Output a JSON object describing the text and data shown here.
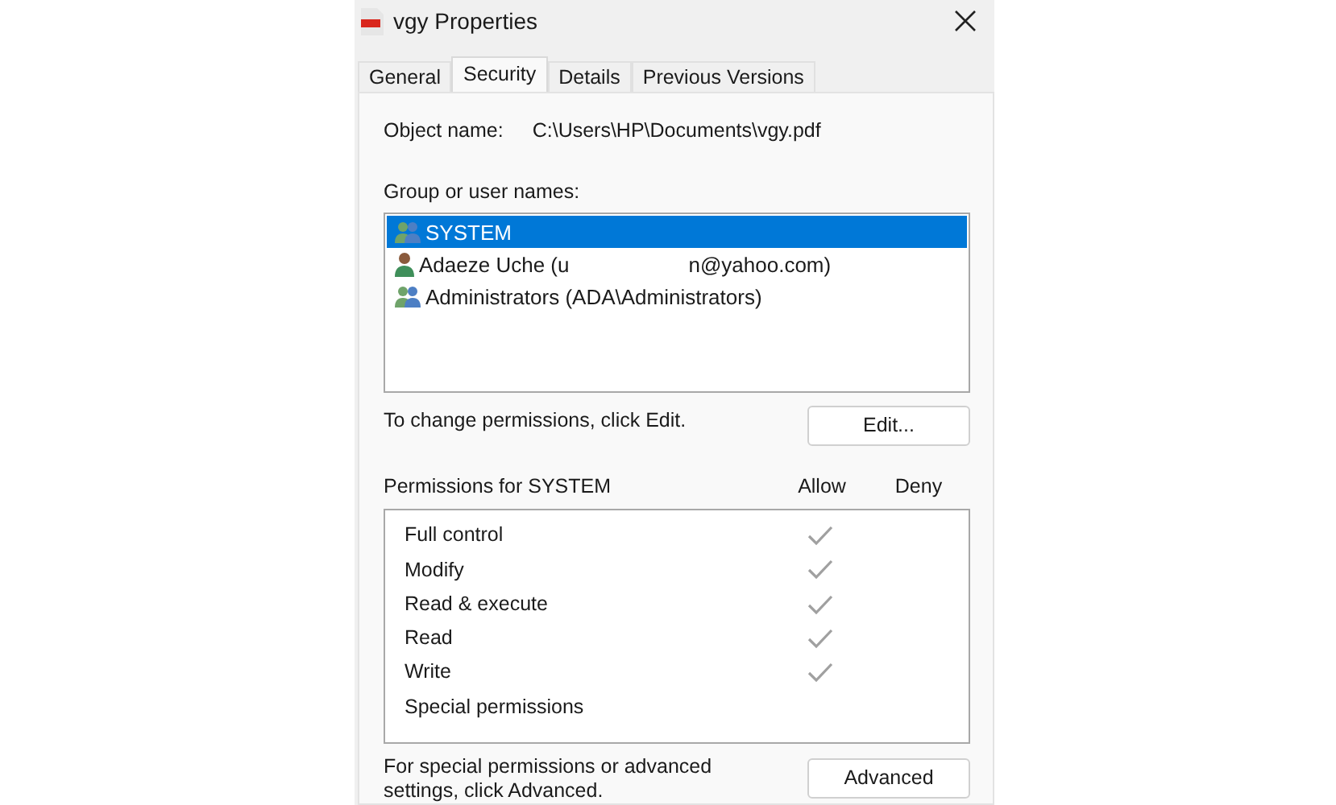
{
  "window": {
    "title": "vgy Properties"
  },
  "tabs": [
    {
      "label": "General",
      "selected": false
    },
    {
      "label": "Security",
      "selected": true
    },
    {
      "label": "Details",
      "selected": false
    },
    {
      "label": "Previous Versions",
      "selected": false
    }
  ],
  "object_name": {
    "label": "Object name:",
    "value": "C:\\Users\\HP\\Documents\\vgy.pdf"
  },
  "users": {
    "label": "Group or user names:",
    "items": [
      {
        "kind": "group",
        "label_parts": [
          "SYSTEM"
        ],
        "selected": true
      },
      {
        "kind": "user",
        "label_parts": [
          "Adaeze Uche (u",
          "n@yahoo.com)"
        ],
        "selected": false
      },
      {
        "kind": "group",
        "label_parts": [
          "Administrators (ADA\\Administrators)"
        ],
        "selected": false
      }
    ]
  },
  "edit_hint": "To change permissions, click Edit.",
  "edit_button": "Edit...",
  "permissions": {
    "title": "Permissions for SYSTEM",
    "allow_header": "Allow",
    "deny_header": "Deny",
    "rows": [
      {
        "name": "Full control",
        "allow": true,
        "deny": false
      },
      {
        "name": "Modify",
        "allow": true,
        "deny": false
      },
      {
        "name": "Read & execute",
        "allow": true,
        "deny": false
      },
      {
        "name": "Read",
        "allow": true,
        "deny": false
      },
      {
        "name": "Write",
        "allow": true,
        "deny": false
      },
      {
        "name": "Special permissions",
        "allow": false,
        "deny": false
      }
    ]
  },
  "advanced_hint": "For special permissions or advanced settings, click Advanced.",
  "advanced_button": "Advanced"
}
